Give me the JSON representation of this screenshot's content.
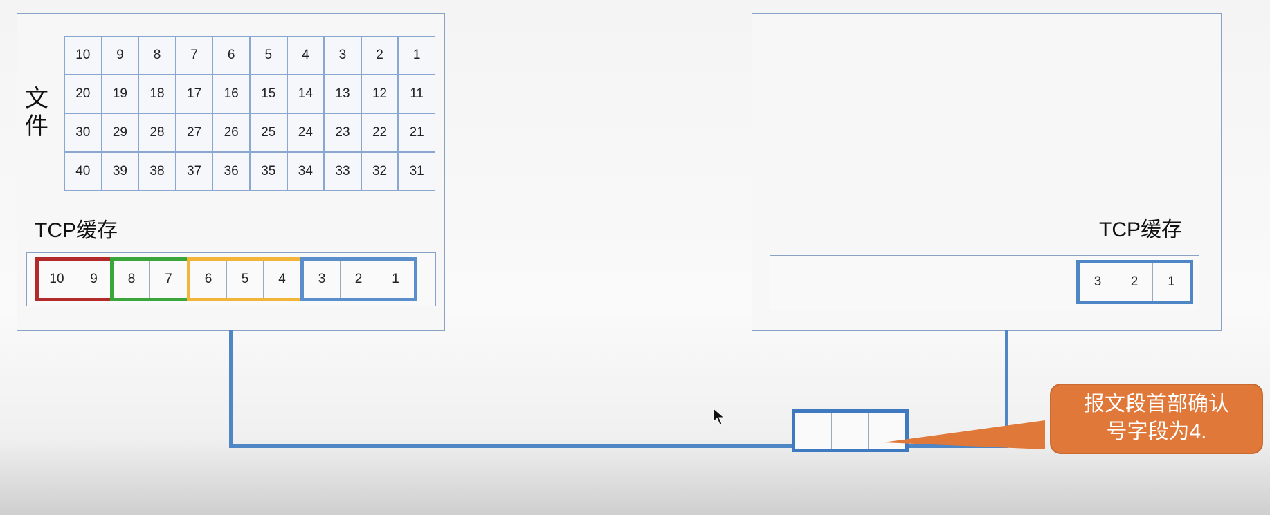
{
  "sender": {
    "file_label": "文件",
    "file_rows": [
      [
        "10",
        "9",
        "8",
        "7",
        "6",
        "5",
        "4",
        "3",
        "2",
        "1"
      ],
      [
        "20",
        "19",
        "18",
        "17",
        "16",
        "15",
        "14",
        "13",
        "12",
        "11"
      ],
      [
        "30",
        "29",
        "28",
        "27",
        "26",
        "25",
        "24",
        "23",
        "22",
        "21"
      ],
      [
        "40",
        "39",
        "38",
        "37",
        "36",
        "35",
        "34",
        "33",
        "32",
        "31"
      ]
    ],
    "tcp_label": "TCP缓存",
    "segments": [
      {
        "color": "#b22a2a",
        "cells": [
          "10",
          "9"
        ]
      },
      {
        "color": "#3aa53a",
        "cells": [
          "8",
          "7"
        ]
      },
      {
        "color": "#f2b53a",
        "cells": [
          "6",
          "5",
          "4"
        ]
      },
      {
        "color": "#5a8fcc",
        "cells": [
          "3",
          "2",
          "1"
        ]
      }
    ]
  },
  "receiver": {
    "tcp_label": "TCP缓存",
    "segment": {
      "color": "#4f86c6",
      "cells": [
        "3",
        "2",
        "1"
      ]
    }
  },
  "packet": {
    "color": "#3f7ac0",
    "cells": [
      "",
      "",
      ""
    ]
  },
  "callout": {
    "line1": "报文段首部确认",
    "line2": "号字段为4.",
    "color": "#e0783a"
  }
}
